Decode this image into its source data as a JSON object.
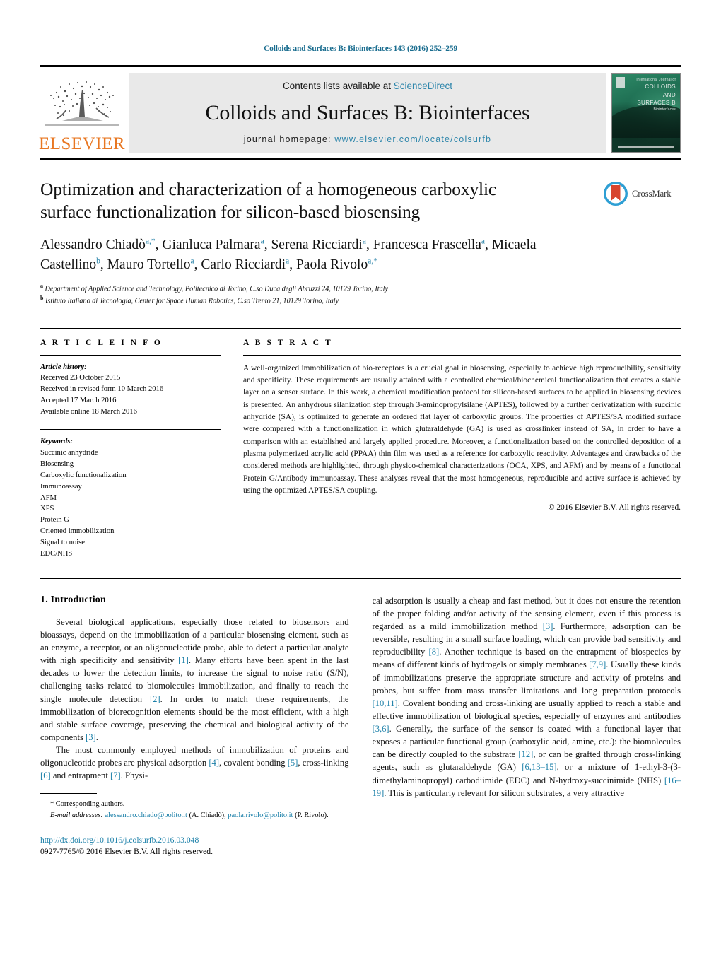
{
  "running_head": "Colloids and Surfaces B: Biointerfaces 143 (2016) 252–259",
  "masthead": {
    "contents_prefix": "Contents lists available at ",
    "sciencedirect": "ScienceDirect",
    "journal_title": "Colloids and Surfaces B: Biointerfaces",
    "homepage_prefix": "journal homepage: ",
    "homepage_url": "www.elsevier.com/locate/colsurfb",
    "publisher_wordmark": "ELSEVIER",
    "cover": {
      "line_small": "International Journal of",
      "line_big_1": "COLLOIDS AND",
      "line_big_2": "SURFACES B",
      "line_sub": "Biointerfaces"
    },
    "colors": {
      "link": "#2e86ab",
      "elsevier_orange": "#e87722",
      "masthead_bg": "#e9e9e9"
    }
  },
  "article": {
    "title": "Optimization and characterization of a homogeneous carboxylic surface functionalization for silicon-based biosensing",
    "authors_line_1": "Alessandro Chiadò",
    "authors_html": "Alessandro Chiadò<sup>a,*</sup>, Gianluca Palmara<sup>a</sup>, Serena Ricciardi<sup>a</sup>, Francesca Frascella<sup>a</sup>, Micaela Castellino<sup>b</sup>, Mauro Tortello<sup>a</sup>, Carlo Ricciardi<sup>a</sup>, Paola Rivolo<sup>a,*</sup>",
    "affiliations": [
      {
        "marker": "a",
        "text": "Department of Applied Science and Technology, Politecnico di Torino, C.so Duca degli Abruzzi 24, 10129 Torino, Italy"
      },
      {
        "marker": "b",
        "text": "Istituto Italiano di Tecnologia, Center for Space Human Robotics, C.so Trento 21, 10129 Torino, Italy"
      }
    ],
    "crossmark_label": "CrossMark"
  },
  "article_info": {
    "heading": "A R T I C L E    I N F O",
    "history_label": "Article history:",
    "history": [
      "Received 23 October 2015",
      "Received in revised form 10 March 2016",
      "Accepted 17 March 2016",
      "Available online 18 March 2016"
    ],
    "keywords_label": "Keywords:",
    "keywords": [
      "Succinic anhydride",
      "Biosensing",
      "Carboxylic functionalization",
      "Immunoassay",
      "AFM",
      "XPS",
      "Protein G",
      "Oriented immobilization",
      "Signal to noise",
      "EDC/NHS"
    ]
  },
  "abstract": {
    "heading": "A B S T R A C T",
    "text": "A well-organized immobilization of bio-receptors is a crucial goal in biosensing, especially to achieve high reproducibility, sensitivity and specificity. These requirements are usually attained with a controlled chemical/biochemical functionalization that creates a stable layer on a sensor surface. In this work, a chemical modification protocol for silicon-based surfaces to be applied in biosensing devices is presented. An anhydrous silanization step through 3-aminopropylsilane (APTES), followed by a further derivatization with succinic anhydride (SA), is optimized to generate an ordered flat layer of carboxylic groups. The properties of APTES/SA modified surface were compared with a functionalization in which glutaraldehyde (GA) is used as crosslinker instead of SA, in order to have a comparison with an established and largely applied procedure. Moreover, a functionalization based on the controlled deposition of a plasma polymerized acrylic acid (PPAA) thin film was used as a reference for carboxylic reactivity. Advantages and drawbacks of the considered methods are highlighted, through physico-chemical characterizations (OCA, XPS, and AFM) and by means of a functional Protein G/Antibody immunoassay. These analyses reveal that the most homogeneous, reproducible and active surface is achieved by using the optimized APTES/SA coupling.",
    "copyright": "© 2016 Elsevier B.V. All rights reserved."
  },
  "body": {
    "section_title": "1.  Introduction",
    "left_paragraphs": [
      "Several biological applications, especially those related to biosensors and bioassays, depend on the immobilization of a particular biosensing element, such as an enzyme, a receptor, or an oligonucleotide probe, able to detect a particular analyte with high specificity and sensitivity [1]. Many efforts have been spent in the last decades to lower the detection limits, to increase the signal to noise ratio (S/N), challenging tasks related to biomolecules immobilization, and finally to reach the single molecule detection [2]. In order to match these requirements, the immobilization of biorecognition elements should be the most efficient, with a high and stable surface coverage, preserving the chemical and biological activity of the components [3].",
      "The most commonly employed methods of immobilization of proteins and oligonucleotide probes are physical adsorption [4], covalent bonding [5], cross-linking [6] and entrapment [7]. Physi-"
    ],
    "right_paragraphs": [
      "cal adsorption is usually a cheap and fast method, but it does not ensure the retention of the proper folding and/or activity of the sensing element, even if this process is regarded as a mild immobilization method [3]. Furthermore, adsorption can be reversible, resulting in a small surface loading, which can provide bad sensitivity and reproducibility [8]. Another technique is based on the entrapment of biospecies by means of different kinds of hydrogels or simply membranes [7,9]. Usually these kinds of immobilizations preserve the appropriate structure and activity of proteins and probes, but suffer from mass transfer limitations and long preparation protocols [10,11]. Covalent bonding and cross-linking are usually applied to reach a stable and effective immobilization of biological species, especially of enzymes and antibodies [3,6]. Generally, the surface of the sensor is coated with a functional layer that exposes a particular functional group (carboxylic acid, amine, etc.): the biomolecules can be directly coupled to the substrate [12], or can be grafted through cross-linking agents, such as glutaraldehyde (GA) [6,13–15], or a mixture of 1-ethyl-3-(3-dimethylaminopropyl) carbodiimide (EDC) and N-hydroxy-succinimide (NHS) [16–19]. This is particularly relevant for silicon substrates, a very attractive"
    ]
  },
  "footnote": {
    "corresponding": "*  Corresponding authors.",
    "email_label": "E-mail addresses:",
    "email_1": "alessandro.chiado@polito.it",
    "email_1_person": "(A. Chiadò),",
    "email_2": "paola.rivolo@polito.it",
    "email_2_person": "(P. Rivolo).",
    "doi": "http://dx.doi.org/10.1016/j.colsurfb.2016.03.048",
    "issn_line": "0927-7765/© 2016 Elsevier B.V. All rights reserved."
  }
}
